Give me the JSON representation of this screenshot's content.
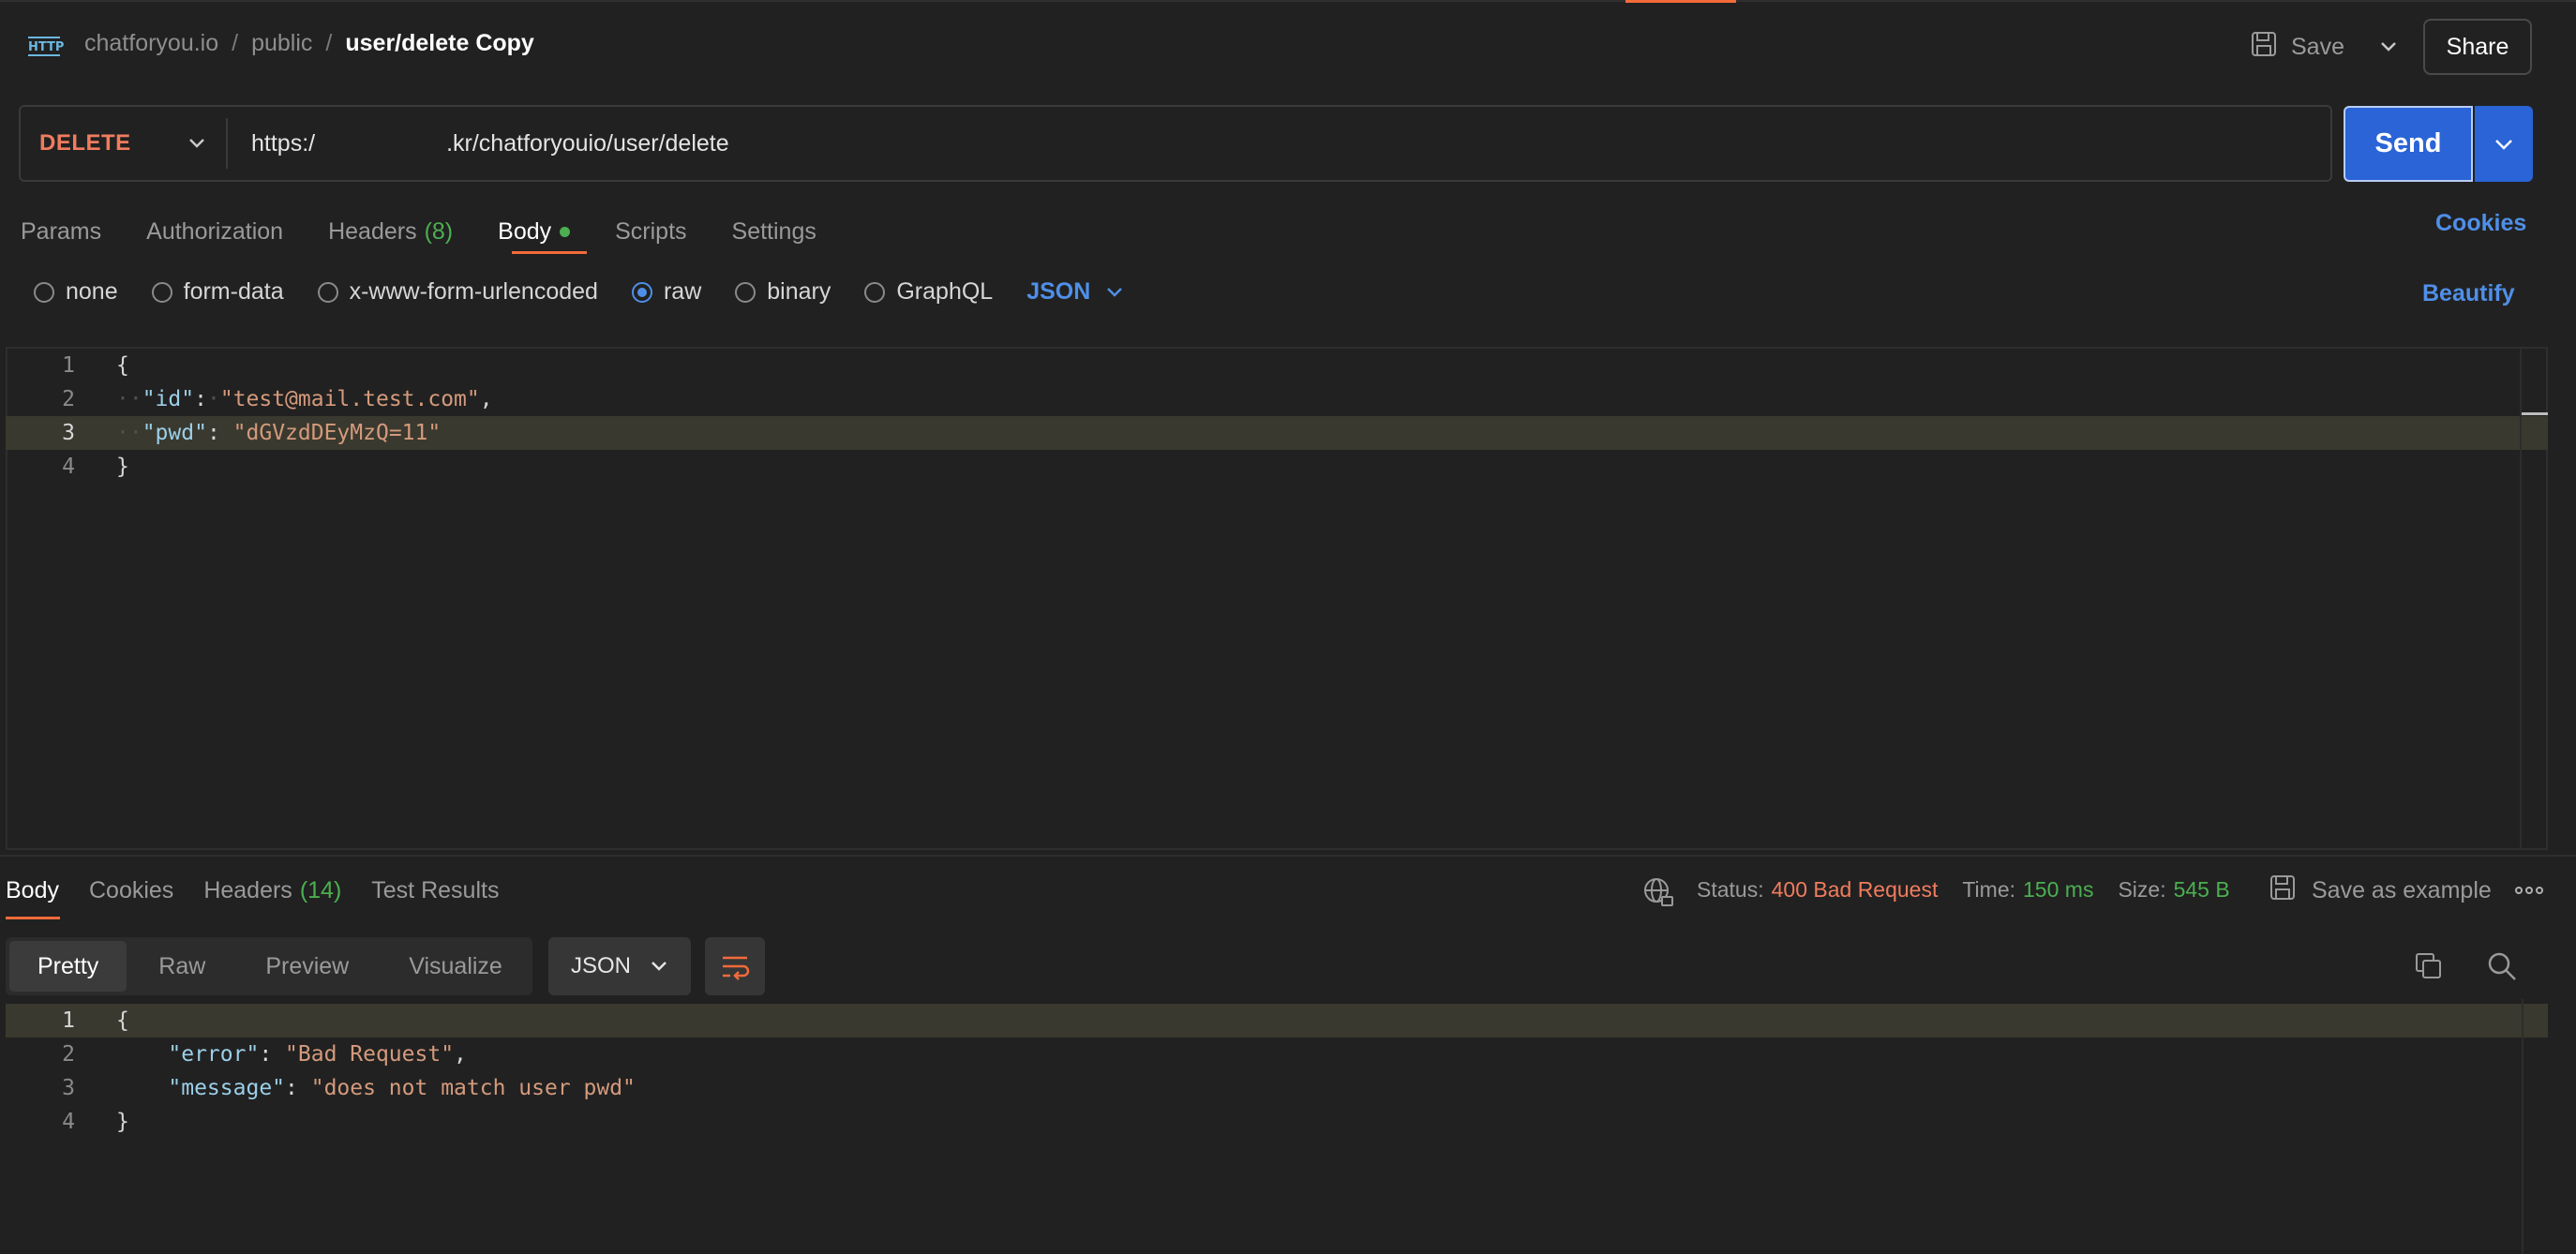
{
  "breadcrumb": {
    "workspace": "chatforyou.io",
    "collection": "public",
    "request": "user/delete Copy"
  },
  "header": {
    "save_label": "Save",
    "share_label": "Share"
  },
  "request": {
    "method": "DELETE",
    "url_prefix": "https:/",
    "url_suffix": ".kr/chatforyouio/user/delete",
    "send_label": "Send"
  },
  "request_tabs": {
    "params": "Params",
    "authorization": "Authorization",
    "headers": "Headers",
    "headers_count": "(8)",
    "body": "Body",
    "scripts": "Scripts",
    "settings": "Settings",
    "cookies": "Cookies"
  },
  "body_types": {
    "none": "none",
    "form_data": "form-data",
    "urlencoded": "x-www-form-urlencoded",
    "raw": "raw",
    "binary": "binary",
    "graphql": "GraphQL",
    "language": "JSON",
    "beautify": "Beautify",
    "selected": "raw"
  },
  "request_body": {
    "line_numbers": [
      "1",
      "2",
      "3",
      "4"
    ],
    "open_brace": "{",
    "close_brace": "}",
    "id_key": "\"id\"",
    "id_value": "\"test@mail.test.com\"",
    "pwd_key": "\"pwd\"",
    "pwd_value": "\"dGVzdDEyMzQ=11\""
  },
  "response_tabs": {
    "body": "Body",
    "cookies": "Cookies",
    "headers": "Headers",
    "headers_count": "(14)",
    "test_results": "Test Results"
  },
  "response_meta": {
    "status_label": "Status:",
    "status_value": "400 Bad Request",
    "time_label": "Time:",
    "time_value": "150 ms",
    "size_label": "Size:",
    "size_value": "545 B",
    "save_example": "Save as example"
  },
  "response_view": {
    "pretty": "Pretty",
    "raw": "Raw",
    "preview": "Preview",
    "visualize": "Visualize",
    "format": "JSON"
  },
  "response_body": {
    "line_numbers": [
      "1",
      "2",
      "3",
      "4"
    ],
    "open_brace": "{",
    "close_brace": "}",
    "error_key": "\"error\"",
    "error_value": "\"Bad Request\"",
    "message_key": "\"message\"",
    "message_value": "\"does not match user pwd\""
  },
  "colors": {
    "accent_orange": "#f26b3a",
    "send_blue": "#2a64d6",
    "link_blue": "#4f8fe8",
    "success_green": "#4caf50",
    "error_red": "#f07c5e"
  }
}
